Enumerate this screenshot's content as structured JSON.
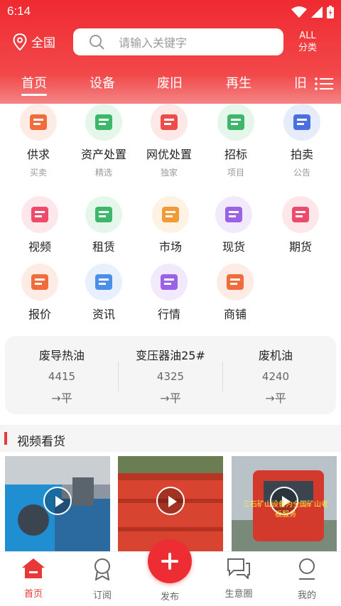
{
  "status_bar": {
    "time": "6:14"
  },
  "header": {
    "location": "全国",
    "search_placeholder": "请输入关键字",
    "all_label": "ALL",
    "category_label": "分类"
  },
  "tabs": [
    "首页",
    "设备",
    "废旧",
    "再生",
    "旧"
  ],
  "grid": [
    {
      "label": "供求",
      "sub": "买卖",
      "icon": "supply-bag-icon",
      "color": "#f26b3a"
    },
    {
      "label": "资产处置",
      "sub": "精选",
      "icon": "asset-building-icon",
      "color": "#3db86a"
    },
    {
      "label": "网优处置",
      "sub": "独家",
      "icon": "network-disposal-icon",
      "color": "#ef4b4b"
    },
    {
      "label": "招标",
      "sub": "项目",
      "icon": "bid-target-icon",
      "color": "#3db86a"
    },
    {
      "label": "拍卖",
      "sub": "公告",
      "icon": "auction-hammer-icon",
      "color": "#4a6fe0"
    },
    {
      "label": "视频",
      "sub": "",
      "icon": "video-icon",
      "color": "#ee4a6a"
    },
    {
      "label": "租赁",
      "sub": "",
      "icon": "rental-tools-icon",
      "color": "#3db86a"
    },
    {
      "label": "市场",
      "sub": "",
      "icon": "market-icon",
      "color": "#f39a36"
    },
    {
      "label": "现货",
      "sub": "",
      "icon": "spot-goods-icon",
      "color": "#9a62e6"
    },
    {
      "label": "期货",
      "sub": "",
      "icon": "futures-icon",
      "color": "#ee4a6a"
    },
    {
      "label": "报价",
      "sub": "",
      "icon": "quote-icon",
      "color": "#f26b3a"
    },
    {
      "label": "资讯",
      "sub": "",
      "icon": "news-icon",
      "color": "#4a8fe8"
    },
    {
      "label": "行情",
      "sub": "",
      "icon": "market-trend-icon",
      "color": "#9a62e6"
    },
    {
      "label": "商铺",
      "sub": "",
      "icon": "shop-icon",
      "color": "#f26b3a"
    }
  ],
  "prices": [
    {
      "name": "废导热油",
      "value": "4415",
      "trend": "→平"
    },
    {
      "name": "变压器油25#",
      "value": "4325",
      "trend": "→平"
    },
    {
      "name": "废机油",
      "value": "4240",
      "trend": "→平"
    }
  ],
  "video_section": {
    "title": "视频看货"
  },
  "videos": [
    {
      "caption": ""
    },
    {
      "caption": ""
    },
    {
      "caption": "三石矿山设备为全国矿山老板服务"
    }
  ],
  "bottom_nav": [
    "首页",
    "订阅",
    "发布",
    "生意圈",
    "我的"
  ],
  "colors": {
    "brand": "#ed2d33"
  }
}
